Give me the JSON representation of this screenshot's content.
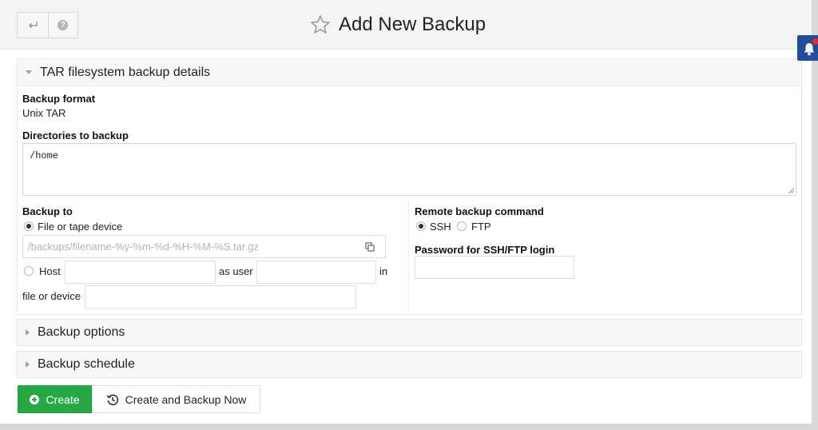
{
  "header": {
    "title": "Add New Backup",
    "icons": [
      "return-arrow-icon",
      "help-icon",
      "star-icon",
      "bell-icon"
    ]
  },
  "details_panel": {
    "title": "TAR filesystem backup details",
    "backup_format_label": "Backup format",
    "backup_format_value": "Unix TAR",
    "directories_label": "Directories to backup",
    "directories_value": "/home",
    "backup_to_label": "Backup to",
    "file_option_label": "File or tape device",
    "file_option_selected": true,
    "file_path_placeholder": "/backups/filename-%y-%m-%d-%H-%M-%S.tar.gz",
    "host_option_label": "Host",
    "host_value": "",
    "as_user_label": "as user",
    "user_value": "",
    "in_label": "in",
    "file_or_device_label": "file or device",
    "file_or_device_value": "",
    "remote_cmd_label": "Remote backup command",
    "ssh_label": "SSH",
    "ssh_selected": true,
    "ftp_label": "FTP",
    "ftp_selected": false,
    "password_label": "Password for SSH/FTP login",
    "password_value": ""
  },
  "sections": {
    "backup_options": "Backup options",
    "backup_schedule": "Backup schedule"
  },
  "actions": {
    "create_label": "Create",
    "create_backup_now_label": "Create and Backup Now"
  },
  "colors": {
    "create_button": "#28a745",
    "notification": "#204d9c",
    "notification_dot": "#e52b2b"
  }
}
